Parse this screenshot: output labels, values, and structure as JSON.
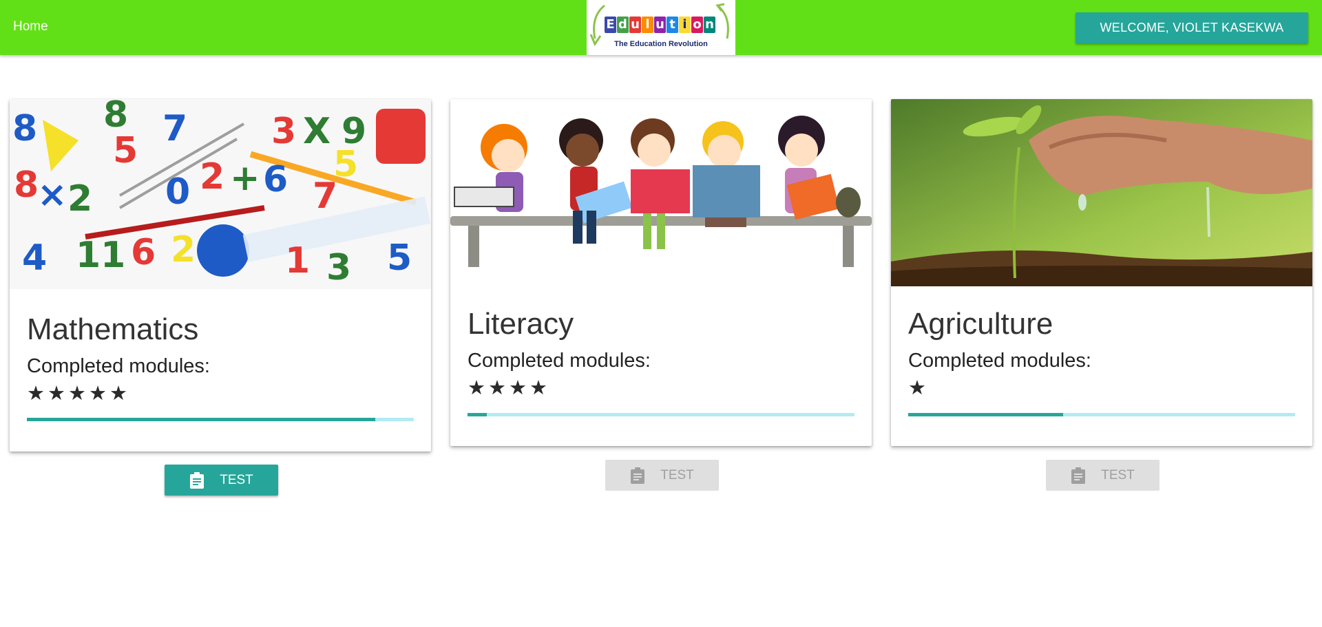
{
  "header": {
    "home_label": "Home",
    "logo": {
      "word": "Edulution",
      "tagline": "The Education Revolution"
    },
    "welcome_label": "WELCOME, VIOLET KASEKWA",
    "bar_color": "#62e017"
  },
  "subjects": [
    {
      "title": "Mathematics",
      "completed_label": "Completed modules:",
      "stars_text": "★★★★★",
      "stars": 5,
      "progress": 0.9,
      "test_label": "TEST",
      "test_enabled": true,
      "image_icon": "math-numbers-image"
    },
    {
      "title": "Literacy",
      "completed_label": "Completed modules:",
      "stars_text": "★★★★",
      "stars": 4,
      "progress": 0.05,
      "test_label": "TEST",
      "test_enabled": false,
      "image_icon": "children-reading-image"
    },
    {
      "title": "Agriculture",
      "completed_label": "Completed modules:",
      "stars_text": "★",
      "stars": 1,
      "progress": 0.4,
      "test_label": "TEST",
      "test_enabled": false,
      "image_icon": "seedling-water-image"
    }
  ],
  "colors": {
    "accent": "#26a69a",
    "progress_track": "#b2ebf2",
    "disabled_bg": "#dfdfdf",
    "disabled_text": "#9f9f9f"
  }
}
